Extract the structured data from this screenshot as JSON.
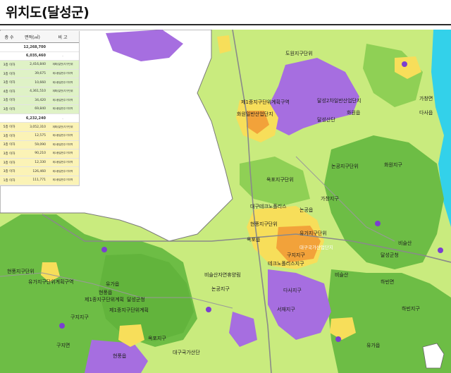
{
  "title": "위치도(달성군)",
  "colors": {
    "green_zone": "#6dbd45",
    "light_green": "#c9eb7e",
    "purple_zone": "#a66ee0",
    "yellow_zone": "#f7de5a",
    "orange_zone": "#f2a23a",
    "water": "#33d1ea",
    "road": "#8a8a8a"
  },
  "legend": {
    "headers": [
      "층 수",
      "면적(㎡)",
      "비 고"
    ],
    "rows": [
      {
        "floor": "",
        "area": "12,268,700",
        "note": "",
        "style": "blank"
      },
      {
        "floor": "",
        "area": "6,035,460",
        "note": "-",
        "style": "blank"
      },
      {
        "floor": "3층 이하",
        "area": "2,416,840",
        "note": "계획(일반)지구단위",
        "style": "green"
      },
      {
        "floor": "3층 이하",
        "area": "39,675",
        "note": "제1종일반주거지역",
        "style": "green"
      },
      {
        "floor": "3층 이하",
        "area": "10,660",
        "note": "제1종일반주거지역",
        "style": "green"
      },
      {
        "floor": "4층 이하",
        "area": "4,361,510",
        "note": "계획(일반)지구단위",
        "style": "green"
      },
      {
        "floor": "3층 이하",
        "area": "34,420",
        "note": "제1종일반주거지역",
        "style": "green"
      },
      {
        "floor": "3층 이하",
        "area": "69,840",
        "note": "제1종일반주거지역",
        "style": "green"
      },
      {
        "floor": "",
        "area": "6,232,240",
        "note": "-",
        "style": "blank"
      },
      {
        "floor": "5층 이하",
        "area": "3,052,310",
        "note": "계획(일반)지구단위",
        "style": "yellow"
      },
      {
        "floor": "3층 이하",
        "area": "12,575",
        "note": "제1종일반주거지역",
        "style": "yellow"
      },
      {
        "floor": "3층 이하",
        "area": "59,090",
        "note": "제1종일반주거지역",
        "style": "yellow"
      },
      {
        "floor": "3층 이하",
        "area": "90,210",
        "note": "제1종일반주거지역",
        "style": "yellow"
      },
      {
        "floor": "3층 이하",
        "area": "12,330",
        "note": "제1종일반주거지역",
        "style": "yellow"
      },
      {
        "floor": "3층 이하",
        "area": "126,460",
        "note": "제1종일반주거지역",
        "style": "yellow"
      },
      {
        "floor": "1층 이하",
        "area": "111,771",
        "note": "제1종일반주거지역",
        "style": "yellow"
      }
    ]
  },
  "map_labels": {
    "l01": "도원지구단위",
    "l02": "제1종지구단위계획구역",
    "l03": "화원일반산업단지",
    "l04": "달성2차일반산업단지",
    "l05": "옥포지구단위",
    "l06": "대구테크노폴리스",
    "l07": "현풍지구단위",
    "l08": "유가지구단위",
    "l09": "대구국가산업단지",
    "l10": "구지지구",
    "l11": "비슬산",
    "l12": "달성군청",
    "l13": "논공지구단위",
    "l14": "화원지구",
    "l15": "가창지구",
    "l16": "하빈지구",
    "l17": "다사지구",
    "l18": "서재지구",
    "l19": "비슬산자연휴양림",
    "l20": "유가읍",
    "l21": "현풍읍",
    "l22": "구지면",
    "l23": "제1종지구단위계획",
    "l24": "테크노폴리스지구",
    "l25": "옥포읍",
    "l26": "논공읍",
    "l27": "가창면",
    "l28": "달성산단",
    "l29": "화원읍",
    "l30": "다사읍",
    "l31": "하빈면",
    "l32": "비슬산",
    "l33": "현풍지구단위",
    "l34": "유가지구단위계획구역",
    "l35": "구지지구",
    "l36": "제1종지구단위계획",
    "l37": "달성군청",
    "l38": "논공지구",
    "l39": "옥포지구",
    "l40": "대구국가산단",
    "l41": "현풍읍",
    "l42": "유가읍"
  }
}
